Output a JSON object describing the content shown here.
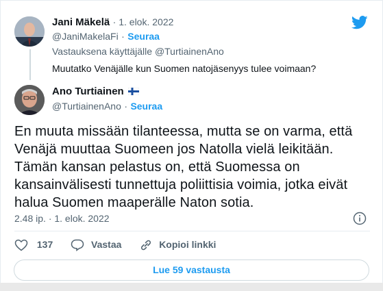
{
  "parent": {
    "name": "Jani Mäkelä",
    "date": "· 1. elok. 2022",
    "handle": "@JaniMakelaFi",
    "separator": "·",
    "follow": "Seuraa",
    "reply_to": "Vastauksena käyttäjälle @TurtiainenAno",
    "text": "Muutatko Venäjälle kun Suomen natojäsenyys tulee voimaan?"
  },
  "tweet": {
    "name": "Ano Turtiainen",
    "handle": "@TurtiainenAno",
    "separator": "·",
    "follow": "Seuraa",
    "text_lines": [
      "En muuta missään tilanteessa, mutta se on varma, että",
      "Venäjä muuttaa Suomeen jos Natolla vielä leikitään.",
      "Tämän kansan pelastus on, että Suomessa on",
      "kansainvälisesti tunnettuja poliittisia voimia, jotka eivät",
      "halua Suomen maaperälle Naton sotia."
    ],
    "timestamp": "2.48 ip. · 1. elok. 2022",
    "likes": "137",
    "reply_label": "Vastaa",
    "copy_label": "Kopioi linkki",
    "read_replies": "Lue 59 vastausta"
  },
  "colors": {
    "accent": "#1d9bf0",
    "text": "#0f1419",
    "muted": "#536471"
  },
  "icons": [
    "twitter-bird-icon",
    "finland-flag-icon",
    "info-icon",
    "heart-icon",
    "reply-icon",
    "link-icon"
  ]
}
